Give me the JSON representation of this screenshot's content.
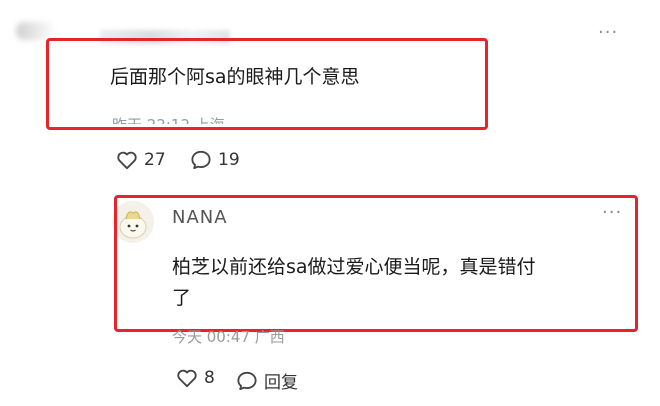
{
  "comment1": {
    "text": "后面那个阿sa的眼神几个意思",
    "meta": "昨天 22:12 上海",
    "likes": "27",
    "replies": "19",
    "like_icon": "heart-outline-icon",
    "reply_icon": "speech-bubble-icon"
  },
  "comment2": {
    "username": "NANA",
    "text_line1": "柏芝以前还给sa做过爱心便当呢，真是错付",
    "text_line2": "了",
    "meta": "今天 00:47 广西",
    "likes": "8",
    "reply_label": "回复",
    "like_icon": "heart-outline-icon",
    "reply_icon": "speech-bubble-icon"
  },
  "more_icon": "more-dots-icon",
  "colors": {
    "highlight_border": "#e8232a",
    "meta_text": "#9a9a9a"
  }
}
